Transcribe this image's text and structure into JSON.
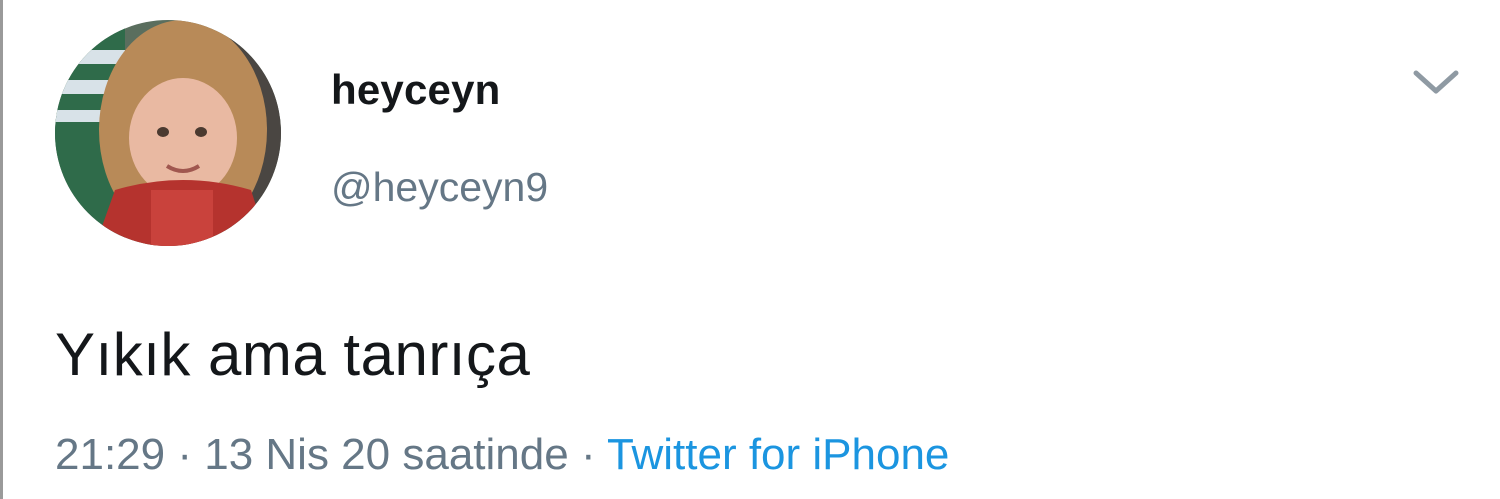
{
  "tweet": {
    "display_name": "heyceyn",
    "handle": "@heyceyn9",
    "text": "Yıkık ama tanrıça",
    "time": "21:29",
    "separator": "·",
    "date": "13 Nis 20 saatinde",
    "source": "Twitter for iPhone"
  },
  "icons": {
    "avatar": "profile-photo",
    "menu": "chevron-down-icon"
  },
  "colors": {
    "text": "#14171a",
    "secondary": "#657786",
    "link": "#1b95e0"
  }
}
